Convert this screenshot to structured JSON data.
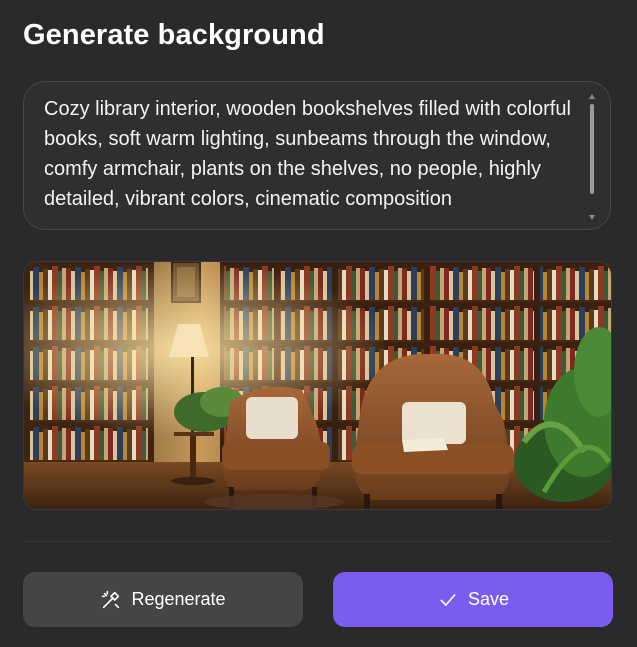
{
  "dialog": {
    "title": "Generate background"
  },
  "prompt": {
    "value": "Cozy library interior, wooden bookshelves filled with colorful books, soft warm lighting, sunbeams through the window, comfy armchair, plants on the shelves, no people, highly detailed, vibrant colors, cinematic composition"
  },
  "preview": {
    "icon": "generated-image"
  },
  "actions": {
    "regenerate_label": "Regenerate",
    "regenerate_icon": "magic-wand-icon",
    "save_label": "Save",
    "save_icon": "checkmark-icon"
  },
  "colors": {
    "background": "#2a2a2c",
    "primary": "#7b5cf0",
    "secondary_button": "#454547"
  }
}
